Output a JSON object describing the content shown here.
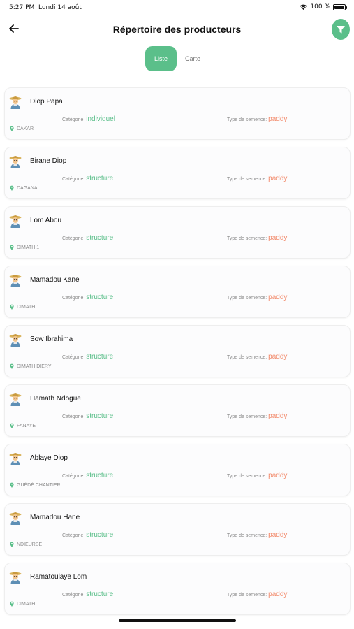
{
  "status": {
    "time": "5:27 PM",
    "date": "Lundi 14 août",
    "battery": "100 %",
    "battery_level": 1.0
  },
  "header": {
    "title": "Répertoire des producteurs"
  },
  "segment": {
    "list_label": "Liste",
    "map_label": "Carte",
    "selected": "Liste"
  },
  "labels": {
    "category": "Catégorie:",
    "seed": "Type de semence:"
  },
  "colors": {
    "accent": "#5bbf8a",
    "seed": "#f28a6b"
  },
  "producers": [
    {
      "name": "Diop Papa",
      "category": "individuel",
      "seed": "paddy",
      "location": "DAKAR"
    },
    {
      "name": "Birane Diop",
      "category": "structure",
      "seed": "paddy",
      "location": "DAGANA"
    },
    {
      "name": "Lom Abou",
      "category": "structure",
      "seed": "paddy",
      "location": "DIMATH 1"
    },
    {
      "name": "Mamadou Kane",
      "category": "structure",
      "seed": "paddy",
      "location": "DIMATH"
    },
    {
      "name": "Sow Ibrahima",
      "category": "structure",
      "seed": "paddy",
      "location": "DIMATH DIERY"
    },
    {
      "name": "Hamath Ndogue",
      "category": "structure",
      "seed": "paddy",
      "location": "FANAYE"
    },
    {
      "name": "Ablaye  Diop",
      "category": "structure",
      "seed": "paddy",
      "location": "GUÉDÉ CHANTIER"
    },
    {
      "name": "Mamadou  Hane",
      "category": "structure",
      "seed": "paddy",
      "location": "NDIEURBE"
    },
    {
      "name": "Ramatoulaye Lom",
      "category": "structure",
      "seed": "paddy",
      "location": "DIMATH"
    }
  ]
}
